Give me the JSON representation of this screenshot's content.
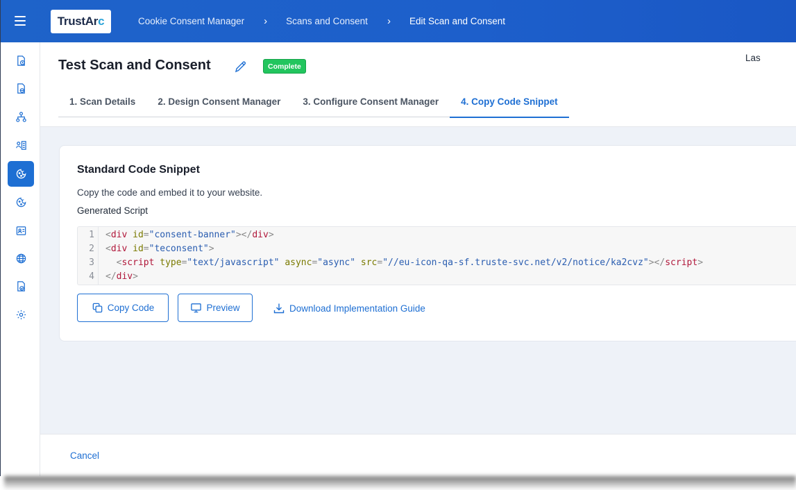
{
  "topbar": {
    "logo_main": "TrustAr",
    "logo_accent": "c",
    "breadcrumbs": [
      "Cookie Consent Manager",
      "Scans and Consent",
      "Edit Scan and Consent"
    ]
  },
  "sidebar": {
    "items": [
      {
        "icon": "document-clock-icon",
        "active": false
      },
      {
        "icon": "document-globe-icon",
        "active": false
      },
      {
        "icon": "network-icon",
        "active": false
      },
      {
        "icon": "person-list-icon",
        "active": false
      },
      {
        "icon": "cookie-icon",
        "active": true
      },
      {
        "icon": "cookie-outline-icon",
        "active": false
      },
      {
        "icon": "id-card-icon",
        "active": false
      },
      {
        "icon": "globe-icon",
        "active": false
      },
      {
        "icon": "document-check-icon",
        "active": false
      },
      {
        "icon": "gear-icon",
        "active": false
      }
    ]
  },
  "header": {
    "title": "Test Scan and Consent",
    "status": "Complete",
    "right_text": "Las"
  },
  "tabs": [
    {
      "label": "1. Scan Details",
      "active": false
    },
    {
      "label": "2. Design Consent Manager",
      "active": false
    },
    {
      "label": "3. Configure Consent Manager",
      "active": false
    },
    {
      "label": "4. Copy Code Snippet",
      "active": true
    }
  ],
  "card": {
    "title": "Standard Code Snippet",
    "description": "Copy the code and embed it to your website.",
    "script_label": "Generated Script",
    "line_numbers": [
      "1",
      "2",
      "3",
      "4"
    ],
    "code": {
      "l1_tag_open": "div",
      "l1_attr": "id",
      "l1_val": "\"consent-banner\"",
      "l1_tag_close": "div",
      "l2_tag_open": "div",
      "l2_attr": "id",
      "l2_val": "\"teconsent\"",
      "l3_tag_open": "script",
      "l3_attr1": "type",
      "l3_val1": "\"text/javascript\"",
      "l3_attr2": "async",
      "l3_val2": "\"async\"",
      "l3_attr3": "src",
      "l3_val3": "\"//eu-icon-qa-sf.truste-svc.net/v2/notice/ka2cvz\"",
      "l3_tag_close": "script",
      "l4_tag_close": "div"
    },
    "buttons": {
      "copy": "Copy Code",
      "preview": "Preview",
      "download": "Download Implementation Guide"
    }
  },
  "footer": {
    "cancel": "Cancel"
  },
  "colors": {
    "brand_blue": "#1e6fd3",
    "topbar_blue": "#1d5fcb",
    "status_green": "#22c55e",
    "content_bg": "#eef2f8"
  }
}
